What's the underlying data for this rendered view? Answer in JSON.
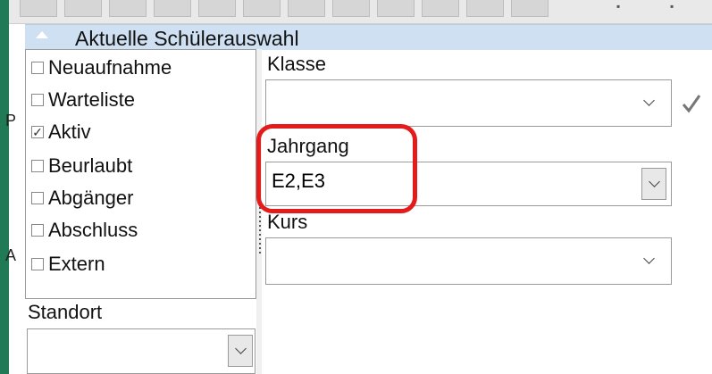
{
  "section": {
    "title": "Aktuelle Schülerauswahl"
  },
  "status_filters": [
    {
      "label": "Neuaufnahme",
      "checked": false
    },
    {
      "label": "Warteliste",
      "checked": false
    },
    {
      "label": "Aktiv",
      "checked": true
    },
    {
      "label": "Beurlaubt",
      "checked": false
    },
    {
      "label": "Abgänger",
      "checked": false
    },
    {
      "label": "Abschluss",
      "checked": false
    },
    {
      "label": "Extern",
      "checked": false
    }
  ],
  "fields": {
    "klasse": {
      "label": "Klasse",
      "value": ""
    },
    "jahrgang": {
      "label": "Jahrgang",
      "value": "E2,E3"
    },
    "kurs": {
      "label": "Kurs",
      "value": ""
    },
    "standort": {
      "label": "Standort",
      "value": ""
    }
  },
  "colors": {
    "highlight": "#e41b1b",
    "header_bg": "#cfe0f2",
    "left_edge": "#1f7a55"
  }
}
